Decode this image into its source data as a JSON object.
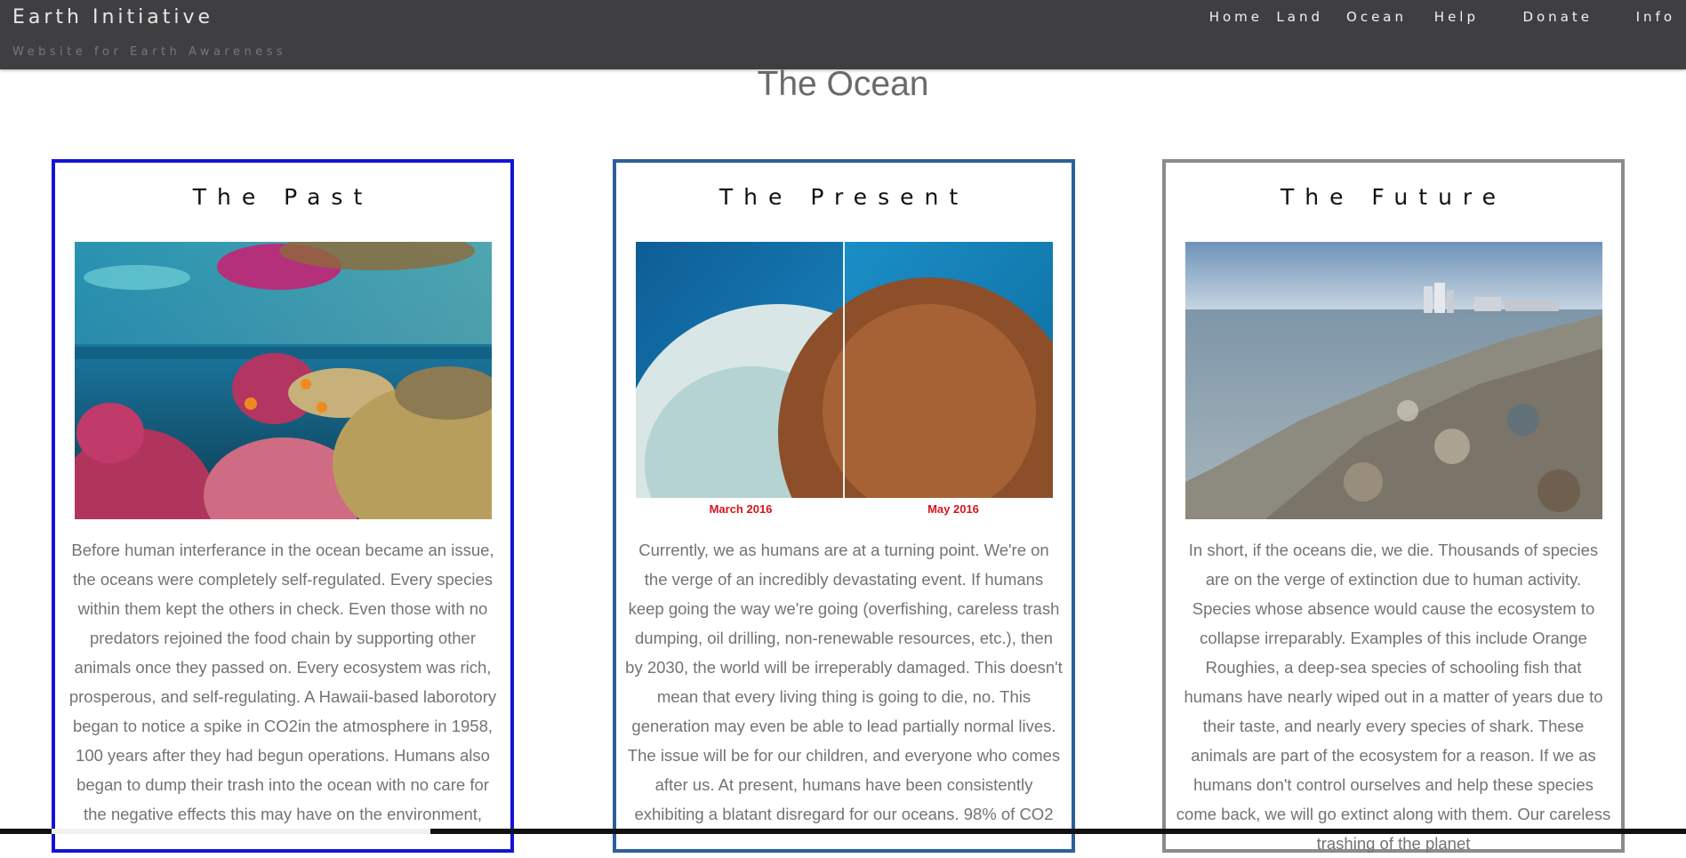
{
  "header": {
    "brand": "Earth Initiative",
    "tagline": "Website for Earth Awareness",
    "nav": [
      "Home",
      "Land",
      "Ocean",
      "Help",
      "Donate",
      "Info"
    ],
    "background": "#3f3f41"
  },
  "page": {
    "title": "The Ocean"
  },
  "cards": [
    {
      "heading": "The Past",
      "border_color": "#1313d8",
      "image": "coral-reef-photo",
      "text": "Before human interferance in the ocean became an issue, the oceans were completely self-regulated. Every species within them kept the others in check. Even those with no predators rejoined the food chain by supporting other animals once they passed on. Every ecosystem was rich, prosperous, and self-regulating. A Hawaii-based laborotory began to notice a spike in CO2in the atmosphere in 1958, 100 years after they had begun operations. Humans also began to dump their trash into the ocean with no care for the negative effects this may have on the environment,"
    },
    {
      "heading": "The Present",
      "border_color": "#2d5f9a",
      "image": "coral-bleaching-comparison-photo",
      "image_captions": [
        "March 2016",
        "May 2016"
      ],
      "text": "Currently, we as humans are at a turning point. We're on the verge of an incredibly devastating event. If humans keep going the way we're going (overfishing, careless trash dumping, oil drilling, non-renewable resources, etc.), then by 2030, the world will be irreperably damaged. This doesn't mean that every living thing is going to die, no. This generation may even be able to lead partially normal lives. The issue will be for our children, and everyone who comes after us. At present, humans have been consistently exhibiting a blatant disregard for our oceans. 98% of CO2"
    },
    {
      "heading": "The Future",
      "border_color": "#8b8b8b",
      "image": "polluted-beach-photo",
      "text": "In short, if the oceans die, we die. Thousands of species are on the verge of extinction due to human activity. Species whose absence would cause the ecosystem to collapse irreparably. Examples of this include Orange Roughies, a deep-sea species of schooling fish that humans have nearly wiped out in a matter of years due to their taste, and nearly every species of shark. These animals are part of the ecosystem for a reason. If we as humans don't control ourselves and help these species come back, we will go extinct along with them. Our careless trashing of the planet"
    }
  ]
}
